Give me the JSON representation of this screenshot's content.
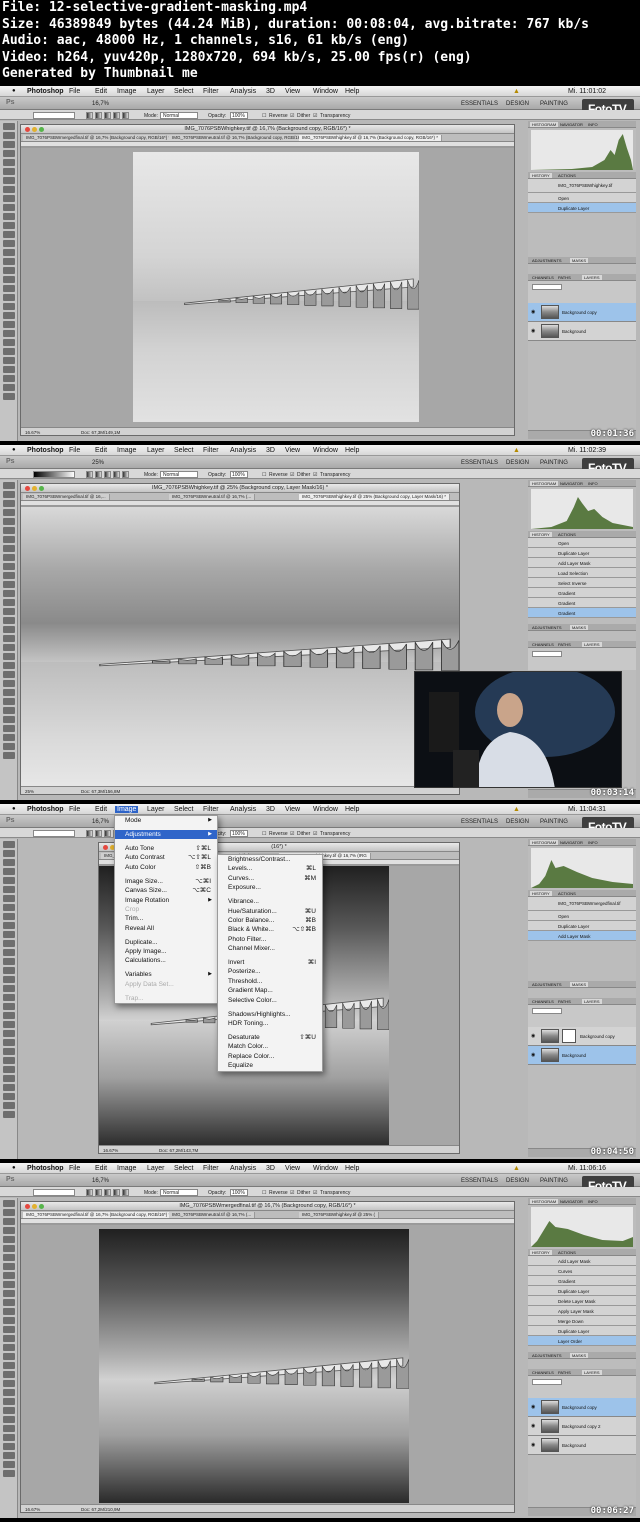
{
  "info": {
    "file": "File: 12-selective-gradient-masking.mp4",
    "size": "Size: 46389849 bytes (44.24 MiB), duration: 00:08:04, avg.bitrate: 767 kb/s",
    "audio": "Audio: aac, 48000 Hz, 1 channels, s16, 61 kb/s (eng)",
    "video": "Video: h264, yuv420p, 1280x720, 694 kb/s, 25.00 fps(r) (eng)",
    "gen": "Generated by Thumbnail me"
  },
  "menu": {
    "app": "Photoshop",
    "items": [
      "File",
      "Edit",
      "Image",
      "Layer",
      "Select",
      "Filter",
      "Analysis",
      "3D",
      "View",
      "Window",
      "Help"
    ]
  },
  "workspaces": [
    "ESSENTIALS",
    "DESIGN",
    "PAINTING"
  ],
  "brand": "FotoTV.",
  "options": {
    "mode_label": "Mode:",
    "mode_value": "Normal",
    "opacity_label": "Opacity:",
    "opacity_value": "100%",
    "reverse": "Reverse",
    "dither": "Dither",
    "transparency": "Transparency"
  },
  "frames": [
    {
      "clock": "Mi. 11:01:02",
      "zoom": "16,7%",
      "title": "IMG_7076PSBWhighkey.tif @ 16,7% (Background copy, RGB/16*) *",
      "tabs": [
        "IMG_7076PSBWmergedfinal.tif @ 16,7% (Background copy, RGB/16*) *",
        "IMG_7076PSBWneutral.tif @ 16,7% (Background copy, RGB/16*) *",
        "IMG_7076PSBWhighkey.tif @ 16,7% (Background copy, RGB/16*) *"
      ],
      "status_zoom": "16.67%",
      "doc": "Doc: 67,3M/149,1M",
      "timestamp": "00:01:36",
      "panel_tabs_top": [
        "HISTOGRAM",
        "NAVIGATOR",
        "INFO"
      ],
      "history_tabs": [
        "HISTORY",
        "ACTIONS"
      ],
      "history_doc": "IMG_7076PSBWhighkey.tif",
      "history": [
        "Open",
        "Duplicate Layer"
      ],
      "history_sel": 1,
      "adj_tabs": [
        "ADJUSTMENTS",
        "MASKS"
      ],
      "layer_tabs": [
        "CHANNELS",
        "PATHS",
        "LAYERS"
      ],
      "layers": [
        "Background copy",
        "Background"
      ],
      "layer_sel": 0
    },
    {
      "clock": "Mi. 11:02:39",
      "zoom": "25%",
      "title": "IMG_7076PSBWhighkey.tif @ 25% (Background copy, Layer Mask/16) *",
      "tabs": [
        "IMG_7076PSBWmergedfinal.tif @ 16,...",
        "IMG_7076PSBWneutral.tif @ 16,7% (...",
        "IMG_7076PSBWhighkey.tif @ 25% (Background copy, Layer Mask/16) *"
      ],
      "status_zoom": "25%",
      "doc": "Doc: 67,3M/156,8M",
      "timestamp": "00:03:14",
      "history": [
        "Open",
        "Duplicate Layer",
        "Add Layer Mask",
        "Load Selection",
        "Select Inverse",
        "Gradient",
        "Gradient",
        "Gradient"
      ],
      "history_sel": 7
    },
    {
      "clock": "Mi. 11:04:31",
      "zoom": "16,7%",
      "title": "(16*) *",
      "tabs": [
        "IMG_7076PSBWmergedfinal.tif",
        "IMG_7076PSBWneutral.tif",
        "IMG_7076PSBWhighkey.tif @ 16,7% (IRG"
      ],
      "status_zoom": "16.67%",
      "doc": "Doc: 67,2M/143,7M",
      "timestamp": "00:04:50",
      "history_doc": "IMG_7076PSBWmergedfinal.tif",
      "history": [
        "Open",
        "Duplicate Layer",
        "Add Layer Mask"
      ],
      "history_sel": 2,
      "layers": [
        "Background copy",
        "Background"
      ],
      "layer_sel": 1,
      "image_menu": [
        {
          "label": "Mode",
          "arrow": true
        },
        {
          "sep": true
        },
        {
          "label": "Adjustments",
          "arrow": true,
          "hl": true
        },
        {
          "sep": true
        },
        {
          "label": "Auto Tone",
          "sc": "⇧⌘L"
        },
        {
          "label": "Auto Contrast",
          "sc": "⌥⇧⌘L"
        },
        {
          "label": "Auto Color",
          "sc": "⇧⌘B"
        },
        {
          "sep": true
        },
        {
          "label": "Image Size...",
          "sc": "⌥⌘I"
        },
        {
          "label": "Canvas Size...",
          "sc": "⌥⌘C"
        },
        {
          "label": "Image Rotation",
          "arrow": true
        },
        {
          "label": "Crop",
          "dis": true
        },
        {
          "label": "Trim..."
        },
        {
          "label": "Reveal All"
        },
        {
          "sep": true
        },
        {
          "label": "Duplicate..."
        },
        {
          "label": "Apply Image..."
        },
        {
          "label": "Calculations..."
        },
        {
          "sep": true
        },
        {
          "label": "Variables",
          "arrow": true
        },
        {
          "label": "Apply Data Set...",
          "dis": true
        },
        {
          "sep": true
        },
        {
          "label": "Trap...",
          "dis": true
        }
      ],
      "adj_menu": [
        {
          "label": "Brightness/Contrast..."
        },
        {
          "label": "Levels...",
          "sc": "⌘L"
        },
        {
          "label": "Curves...",
          "sc": "⌘M"
        },
        {
          "label": "Exposure..."
        },
        {
          "sep": true
        },
        {
          "label": "Vibrance..."
        },
        {
          "label": "Hue/Saturation...",
          "sc": "⌘U"
        },
        {
          "label": "Color Balance...",
          "sc": "⌘B"
        },
        {
          "label": "Black & White...",
          "sc": "⌥⇧⌘B"
        },
        {
          "label": "Photo Filter..."
        },
        {
          "label": "Channel Mixer..."
        },
        {
          "sep": true
        },
        {
          "label": "Invert",
          "sc": "⌘I"
        },
        {
          "label": "Posterize..."
        },
        {
          "label": "Threshold..."
        },
        {
          "label": "Gradient Map..."
        },
        {
          "label": "Selective Color..."
        },
        {
          "sep": true
        },
        {
          "label": "Shadows/Highlights..."
        },
        {
          "label": "HDR Toning..."
        },
        {
          "sep": true
        },
        {
          "label": "Desaturate",
          "sc": "⇧⌘U"
        },
        {
          "label": "Match Color..."
        },
        {
          "label": "Replace Color..."
        },
        {
          "label": "Equalize"
        }
      ]
    },
    {
      "clock": "Mi. 11:06:16",
      "zoom": "16,7%",
      "title": "IMG_7076PSBWmergedfinal.tif @ 16,7% (Background copy, RGB/16*) *",
      "tabs": [
        "IMG_7076PSBWmergedfinal.tif @ 16,7% (Background copy, RGB/16*) *",
        "IMG_7076PSBWneutral.tif @ 16,7% (...",
        "IMG_7076PSBWhighkey.tif @ 25% ("
      ],
      "status_zoom": "16.67%",
      "doc": "Doc: 67,2M/210,9M",
      "timestamp": "00:06:27",
      "history": [
        "Add Layer Mask",
        "Curves",
        "Gradient",
        "Duplicate Layer",
        "Delete Layer Mask",
        "Apply Layer Mask",
        "Merge Down",
        "Duplicate Layer",
        "Layer Order"
      ],
      "history_sel": 8,
      "layers": [
        "Background copy",
        "Background copy 2",
        "Background"
      ],
      "layer_sel": 0
    }
  ]
}
